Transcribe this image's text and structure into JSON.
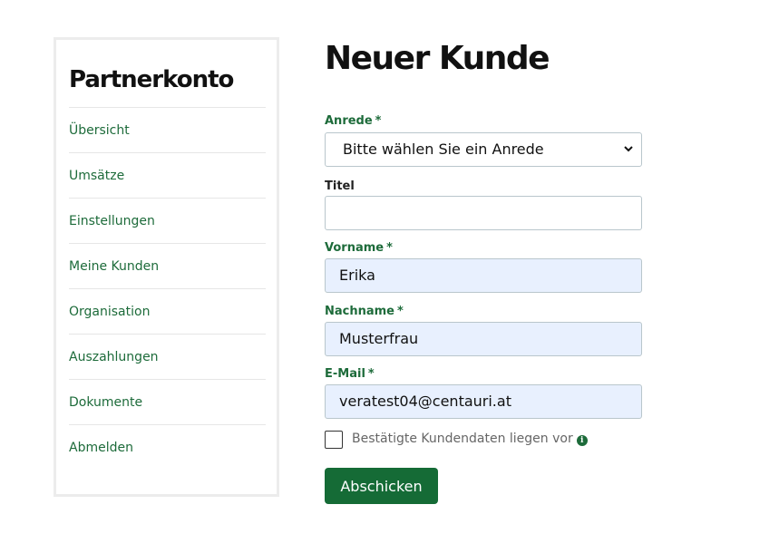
{
  "sidebar": {
    "title": "Partnerkonto",
    "items": [
      {
        "label": "Übersicht"
      },
      {
        "label": "Umsätze"
      },
      {
        "label": "Einstellungen"
      },
      {
        "label": "Meine Kunden"
      },
      {
        "label": "Organisation"
      },
      {
        "label": "Auszahlungen"
      },
      {
        "label": "Dokumente"
      },
      {
        "label": "Abmelden"
      }
    ]
  },
  "form": {
    "title": "Neuer Kunde",
    "required_mark": "*",
    "anrede": {
      "label": "Anrede",
      "value": "Bitte wählen Sie ein Anrede"
    },
    "titel": {
      "label": "Titel",
      "value": ""
    },
    "vorname": {
      "label": "Vorname",
      "value": "Erika"
    },
    "nachname": {
      "label": "Nachname",
      "value": "Musterfrau"
    },
    "email": {
      "label": "E-Mail",
      "value": "veratest04@centauri.at"
    },
    "confirm": {
      "label": "Bestätigte Kundendaten liegen vor",
      "checked": false,
      "icon": "info-icon"
    },
    "submit_label": "Abschicken"
  },
  "colors": {
    "accent": "#1d6b3a",
    "button": "#156b36",
    "autofill": "#e8f0fe"
  }
}
